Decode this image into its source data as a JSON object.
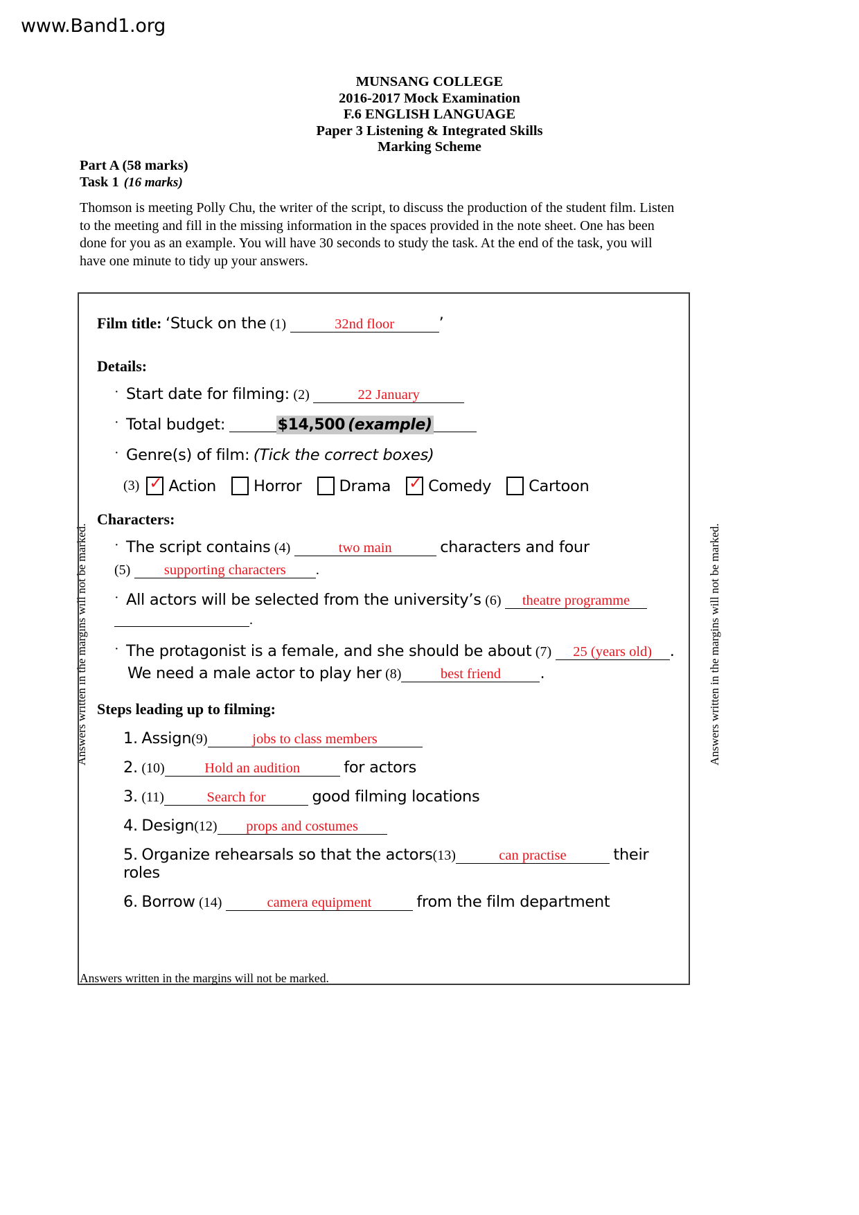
{
  "watermark": {
    "url": "www.Band1.org"
  },
  "exam_heading": {
    "lines": [
      "MUNSANG COLLEGE",
      "2016-2017 Mock Examination",
      "F.6 ENGLISH LANGUAGE",
      "Paper 3 Listening & Integrated Skills",
      "Marking Scheme"
    ]
  },
  "part": {
    "part_label": "Part A (58 marks)",
    "task_label": "Task 1",
    "task_marks": "(16 marks)"
  },
  "instructions": {
    "text": "Thomson is meeting Polly Chu, the writer of the script, to discuss the production of the student film. Listen to the meeting and fill in the missing information in the spaces provided in the note sheet. One has been done for you as an example. You will have 30 seconds to study the task. At the end of the task, you will have one minute to tidy up your answers."
  },
  "margin_notes": {
    "left": "Answers written in the margins will not be marked.",
    "right": "Answers written in the margins will not be marked."
  },
  "note_sheet": {
    "film_title": {
      "label": "Film title:",
      "quote_open": "‘Stuck on the",
      "qn": "(1)",
      "answer": "32nd floor",
      "quote_close": "’"
    },
    "details_head": "Details:",
    "details": {
      "start_date": {
        "text": "Start date for filming:",
        "qn": "(2)",
        "answer": "22 January"
      },
      "total_budget": {
        "text": "Total budget:",
        "example_value": "$14,500",
        "example_tag": "(example)"
      },
      "genres": {
        "text": "Genre(s) of film:",
        "instruction": "(Tick the correct boxes)",
        "qn": "(3)",
        "options": [
          {
            "label": "Action",
            "checked": true
          },
          {
            "label": "Horror",
            "checked": false
          },
          {
            "label": "Drama",
            "checked": false
          },
          {
            "label": "Comedy",
            "checked": true
          },
          {
            "label": "Cartoon",
            "checked": false
          }
        ]
      }
    },
    "characters_head": "Characters:",
    "characters": {
      "script_contains": {
        "pre": "The script contains",
        "qn4": "(4)",
        "answer4": "two main",
        "mid": "characters and four",
        "qn5": "(5)",
        "answer5": "supporting characters",
        "post": "."
      },
      "actors": {
        "pre": "All actors will be selected from the university’s",
        "qn": "(6)",
        "answer": "theatre programme",
        "post": "."
      },
      "protagonist": {
        "pre": "The protagonist is a female, and she should be about",
        "qn": "(7)",
        "answer": "25 (years old)",
        "post": "."
      },
      "male_actor": {
        "pre": "We need a male actor to play her",
        "qn": "(8)",
        "answer": "best friend",
        "post": "."
      }
    },
    "steps_head": "Steps leading up to filming:",
    "steps": [
      {
        "no": "1.",
        "pre": "Assign",
        "qn": "(9)",
        "answer": "jobs to class members",
        "post": ""
      },
      {
        "no": "2.",
        "pre": "",
        "qn": "(10)",
        "answer": "Hold an audition",
        "post": "for actors"
      },
      {
        "no": "3.",
        "pre": "",
        "qn": "(11)",
        "answer": "Search for",
        "post": "good filming locations"
      },
      {
        "no": "4.",
        "pre": "Design",
        "qn": "(12)",
        "answer": "props and costumes",
        "post": ""
      },
      {
        "no": "5.",
        "pre": "Organize rehearsals so that the actors",
        "qn": "(13)",
        "answer": "can practise",
        "post": "their roles"
      },
      {
        "no": "6.",
        "pre": "Borrow",
        "qn": "(14)",
        "answer": "camera equipment",
        "post": "from the film department"
      }
    ]
  },
  "footer": {
    "note": "Answers written in the margins will not be marked."
  },
  "colors": {
    "answer_red": "#e8151c",
    "example_highlight": "#c8c8c8",
    "box_border": "#3a3a3a"
  }
}
